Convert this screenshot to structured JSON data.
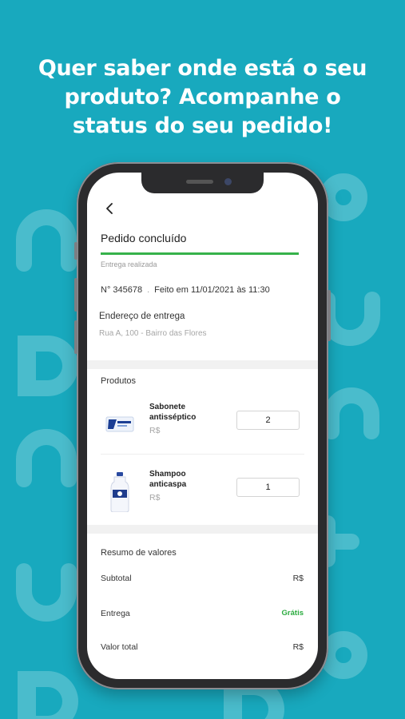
{
  "headline": {
    "line1": "Quer saber onde está o seu",
    "line2": "produto? Acompanhe o",
    "line3": "status do seu pedido!"
  },
  "colors": {
    "background": "#18a9be",
    "accent_green": "#36b24a"
  },
  "order_screen": {
    "back_icon": "chevron-left-icon",
    "title": "Pedido concluído",
    "progress": 1.0,
    "status": "Entrega realizada",
    "order_number": "N° 345678",
    "order_date": "Feito em 11/01/2021 às 11:30",
    "address_label": "Endereço de entrega",
    "address_value": "Rua A, 100 - Bairro das Flores",
    "products_label": "Produtos",
    "products": [
      {
        "name": "Sabonete antisséptico",
        "price": "R$",
        "quantity": "2",
        "icon": "soap-box-icon"
      },
      {
        "name": "Shampoo anticaspa",
        "price": "R$",
        "quantity": "1",
        "icon": "shampoo-bottle-icon"
      }
    ],
    "summary_label": "Resumo de valores",
    "summary": {
      "subtotal_label": "Subtotal",
      "subtotal_value": "R$",
      "delivery_label": "Entrega",
      "delivery_value": "Grátis",
      "total_label": "Valor total",
      "total_value": "R$"
    }
  }
}
